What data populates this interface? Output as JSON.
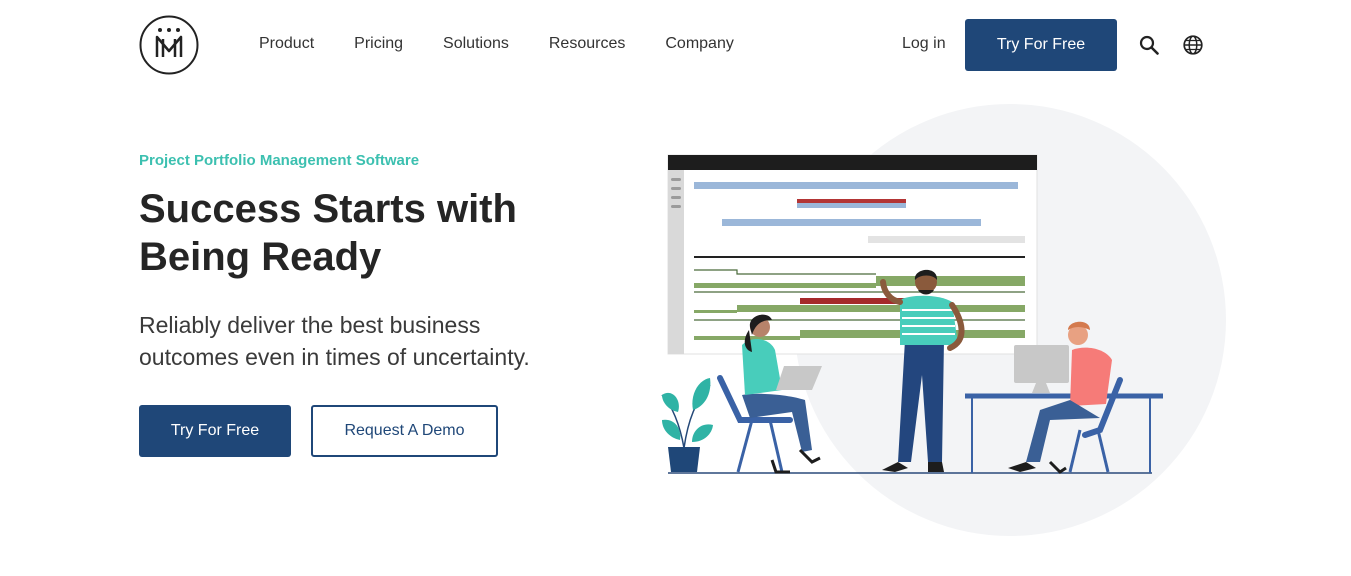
{
  "header": {
    "nav": [
      "Product",
      "Pricing",
      "Solutions",
      "Resources",
      "Company"
    ],
    "login": "Log in",
    "cta": "Try For Free",
    "icons": [
      "logo-icon",
      "search-icon",
      "globe-icon"
    ]
  },
  "hero": {
    "eyebrow": "Project Portfolio Management Software",
    "headline": "Success Starts with Being Ready",
    "subtext": "Reliably deliver the best business outcomes even in times of uncertainty.",
    "primary_cta": "Try For Free",
    "secondary_cta": "Request A Demo"
  },
  "colors": {
    "brand_blue": "#1f4778",
    "accent_teal": "#3cc0b0",
    "gantt_green": "#86a866",
    "gantt_red": "#a52a2a",
    "gantt_blue": "#9bb7d9"
  }
}
